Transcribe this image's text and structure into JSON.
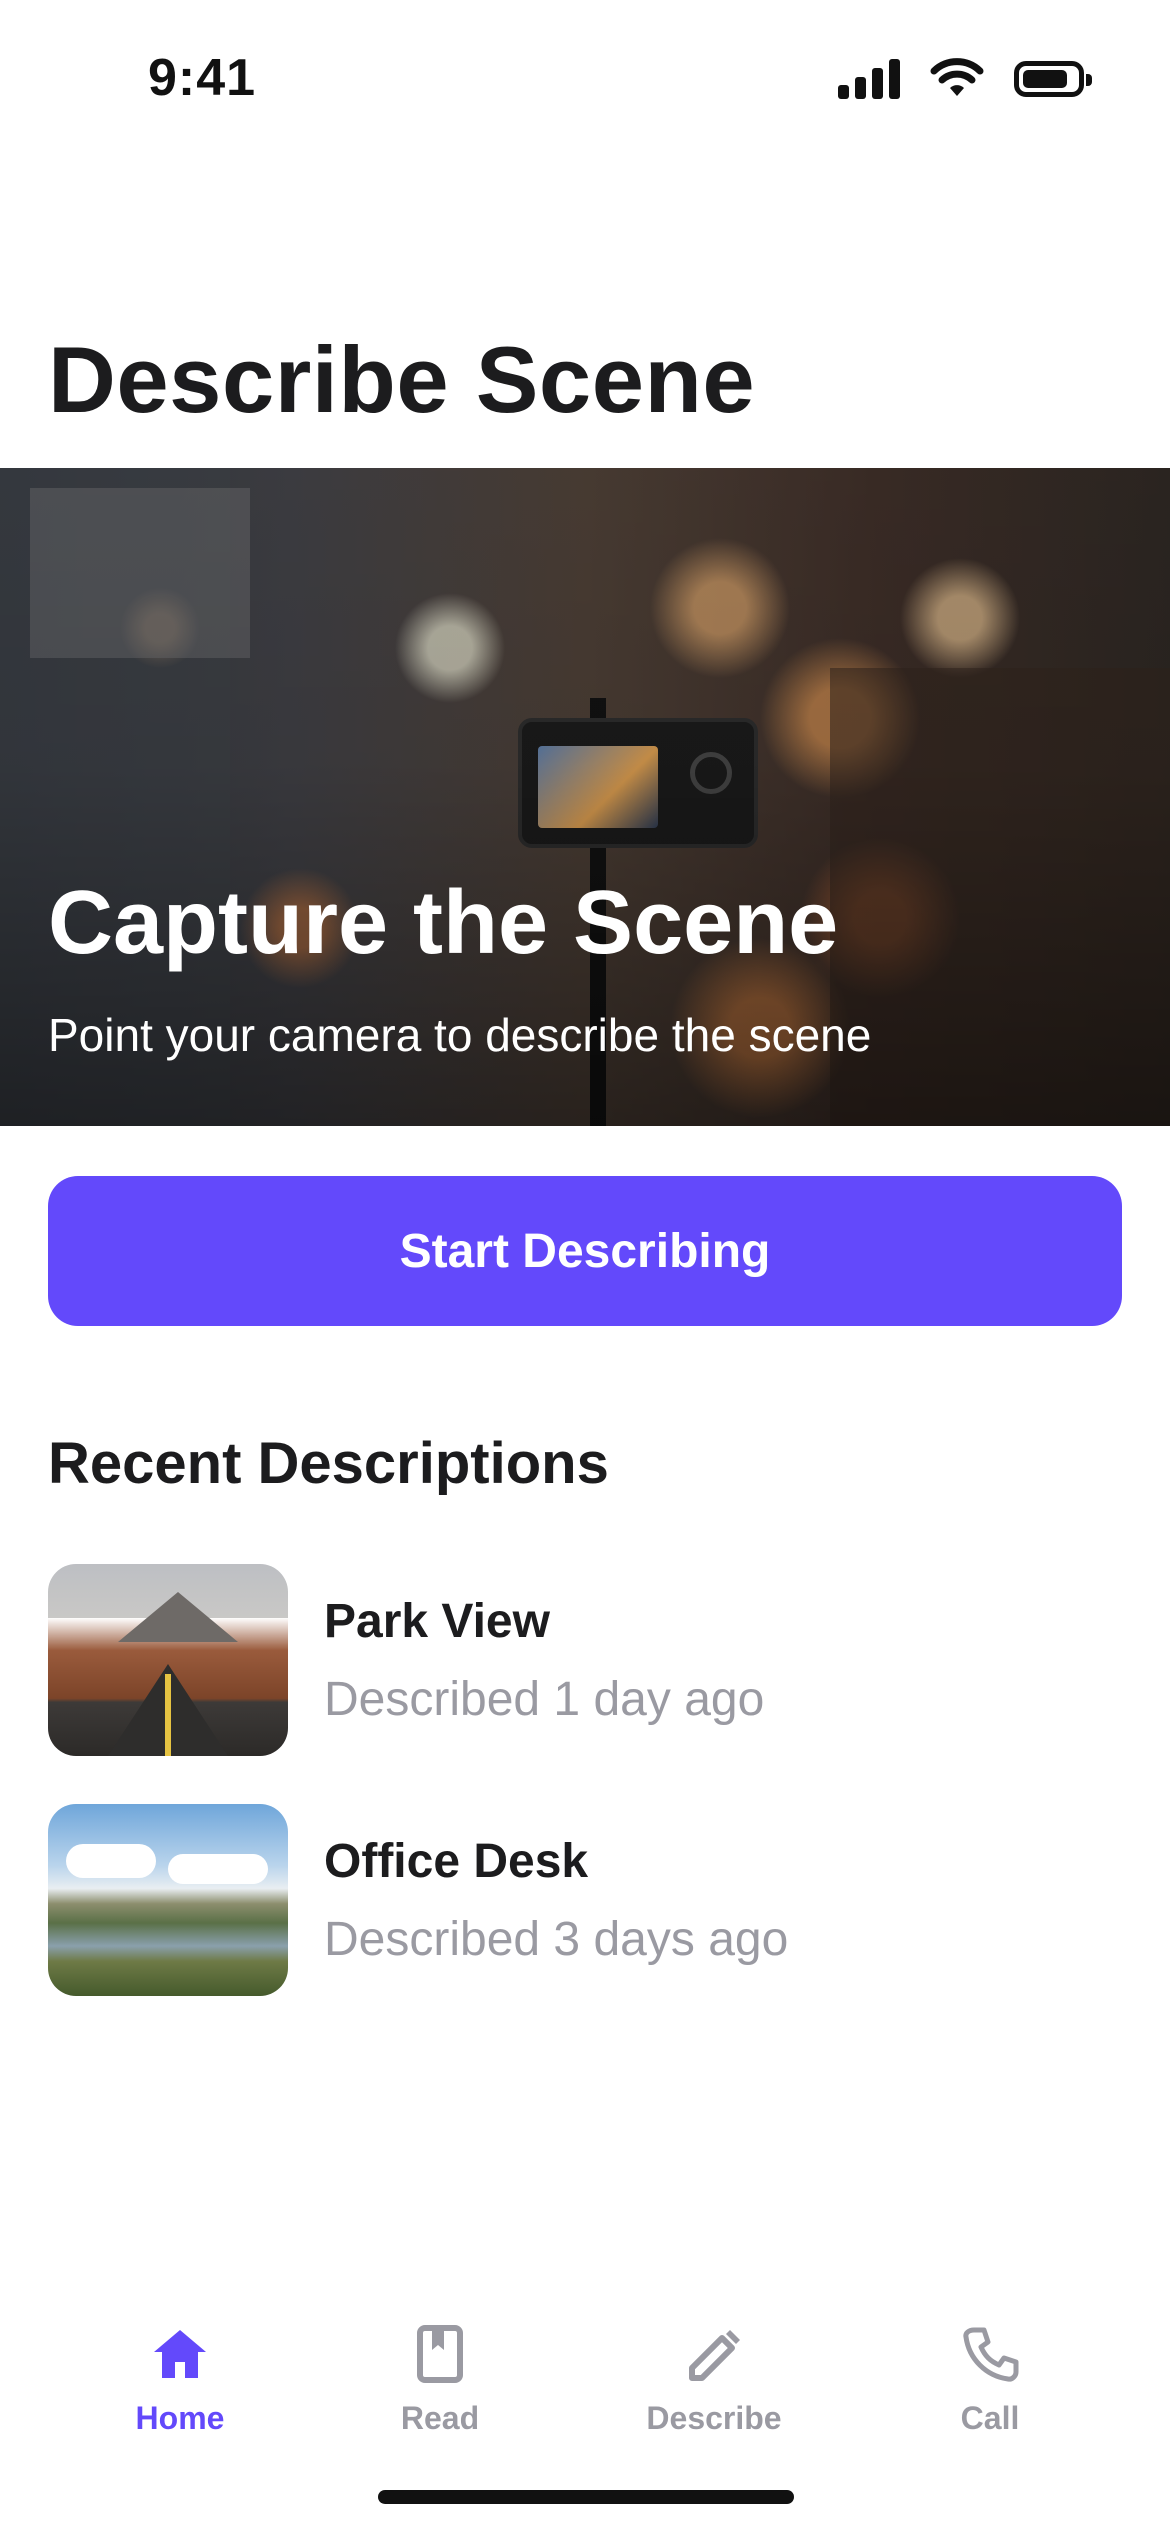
{
  "status_bar": {
    "time": "9:41",
    "icons": [
      "signal-icon",
      "wifi-icon",
      "battery-icon"
    ]
  },
  "page": {
    "title": "Describe Scene"
  },
  "hero": {
    "title": "Capture the Scene",
    "subtitle": "Point your camera to describe the scene"
  },
  "primary_action": {
    "label": "Start Describing"
  },
  "recent": {
    "title": "Recent Descriptions",
    "items": [
      {
        "title": "Park View",
        "subtitle": "Described 1 day ago",
        "thumbnail": "road-photo"
      },
      {
        "title": "Office Desk",
        "subtitle": "Described 3 days ago",
        "thumbnail": "lake-photo"
      }
    ]
  },
  "tab_bar": {
    "active": "Home",
    "tabs": [
      {
        "label": "Home",
        "icon": "home-icon"
      },
      {
        "label": "Read",
        "icon": "book-icon"
      },
      {
        "label": "Describe",
        "icon": "pencil-icon"
      },
      {
        "label": "Call",
        "icon": "phone-icon"
      }
    ]
  },
  "colors": {
    "accent": "#6349fb",
    "text": "#1c1c1e",
    "secondary_text": "#9a9aa2",
    "background": "#ffffff"
  }
}
